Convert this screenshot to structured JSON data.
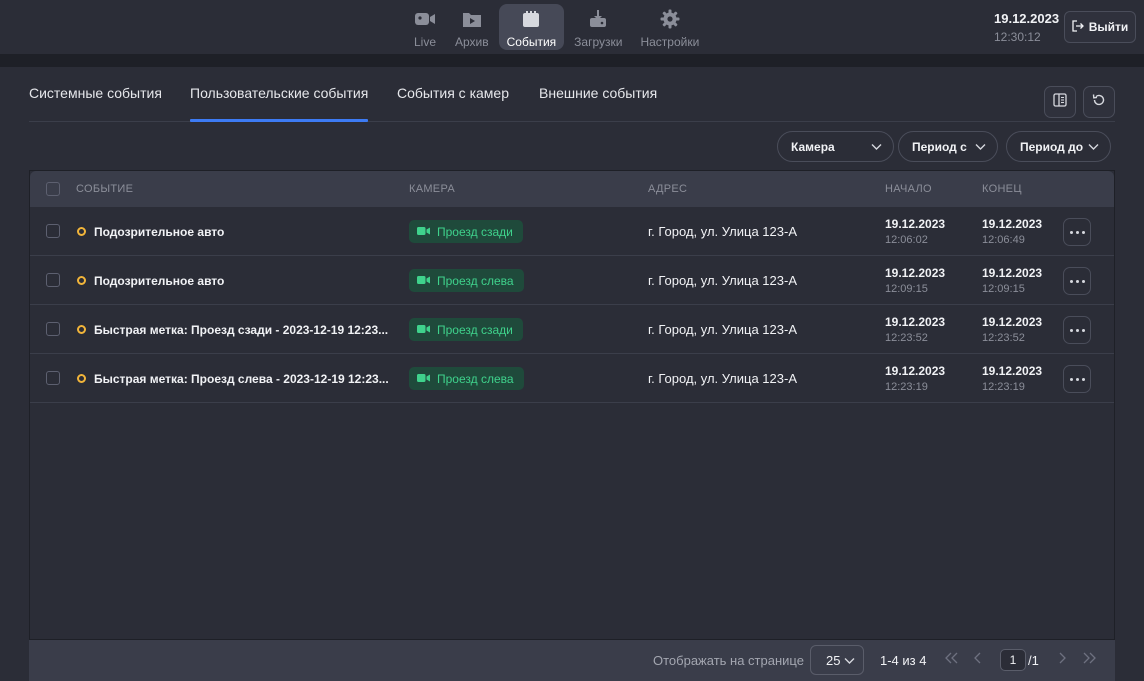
{
  "nav": {
    "items": [
      {
        "label": "Live",
        "icon": "video-camera-icon"
      },
      {
        "label": "Архив",
        "icon": "archive-play-icon"
      },
      {
        "label": "События",
        "icon": "events-icon"
      },
      {
        "label": "Загрузки",
        "icon": "download-icon"
      },
      {
        "label": "Настройки",
        "icon": "gear-icon"
      }
    ],
    "active_index": 2
  },
  "clock": {
    "date": "19.12.2023",
    "time": "12:30:12"
  },
  "logout": {
    "label": "Выйти",
    "icon": "logout-icon"
  },
  "tabs": [
    {
      "label": "Системные события"
    },
    {
      "label": "Пользовательские события"
    },
    {
      "label": "События с камер"
    },
    {
      "label": "Внешние события"
    }
  ],
  "active_tab": 1,
  "toolbar": {
    "columns_icon": "columns-icon",
    "refresh_icon": "refresh-icon"
  },
  "filters": {
    "camera": "Камера",
    "period_from": "Период с",
    "period_to": "Период до"
  },
  "table": {
    "headers": {
      "event": "СОБЫТИЕ",
      "camera": "КАМЕРА",
      "address": "АДРЕС",
      "start": "НАЧАЛО",
      "end": "КОНЕЦ"
    },
    "rows": [
      {
        "event": "Подозрительное авто",
        "camera": "Проезд сзади",
        "address": "г. Город, ул. Улица 123-А",
        "start_date": "19.12.2023",
        "start_time": "12:06:02",
        "end_date": "19.12.2023",
        "end_time": "12:06:49"
      },
      {
        "event": "Подозрительное авто",
        "camera": "Проезд слева",
        "address": "г. Город, ул. Улица 123-А",
        "start_date": "19.12.2023",
        "start_time": "12:09:15",
        "end_date": "19.12.2023",
        "end_time": "12:09:15"
      },
      {
        "event": "Быстрая метка: Проезд сзади - 2023-12-19 12:23...",
        "camera": "Проезд сзади",
        "address": "г. Город, ул. Улица 123-А",
        "start_date": "19.12.2023",
        "start_time": "12:23:52",
        "end_date": "19.12.2023",
        "end_time": "12:23:52"
      },
      {
        "event": "Быстрая метка: Проезд слева - 2023-12-19 12:23...",
        "camera": "Проезд слева",
        "address": "г. Город, ул. Улица 123-А",
        "start_date": "19.12.2023",
        "start_time": "12:23:19",
        "end_date": "19.12.2023",
        "end_time": "12:23:19"
      }
    ]
  },
  "pagination": {
    "per_page_label": "Отображать на странице",
    "per_page": "25",
    "range": "1-4 из 4",
    "page": "1",
    "total": "/1"
  },
  "colors": {
    "accent": "#3d7bf4",
    "status_dot": "#f2b53a",
    "camera_badge_bg": "#1f4a3b",
    "camera_badge_text": "#3fd28c"
  }
}
